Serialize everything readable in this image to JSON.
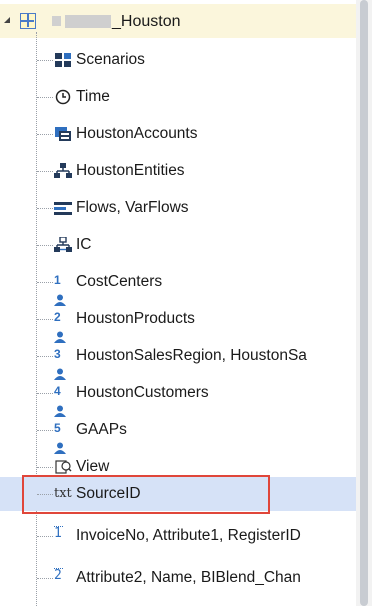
{
  "tree": {
    "root": {
      "label": "_Houston",
      "icon": "cube-grid-icon"
    },
    "items": [
      {
        "label": "Scenarios",
        "icon": "scenarios-icon"
      },
      {
        "label": "Time",
        "icon": "clock-icon"
      },
      {
        "label": "HoustonAccounts",
        "icon": "accounts-icon"
      },
      {
        "label": "HoustonEntities",
        "icon": "hierarchy-icon"
      },
      {
        "label": "Flows, VarFlows",
        "icon": "flows-icon"
      },
      {
        "label": "IC",
        "icon": "ic-hierarchy-icon"
      },
      {
        "label": "CostCenters",
        "icon": "ud1-person-icon",
        "badge": "1"
      },
      {
        "label": "HoustonProducts",
        "icon": "ud2-person-icon",
        "badge": "2"
      },
      {
        "label": "HoustonSalesRegion, HoustonSa",
        "icon": "ud3-person-icon",
        "badge": "3"
      },
      {
        "label": "HoustonCustomers",
        "icon": "ud4-person-icon",
        "badge": "4"
      },
      {
        "label": "GAAPs",
        "icon": "ud5-person-icon",
        "badge": "5"
      },
      {
        "label": "View",
        "icon": "view-icon"
      },
      {
        "label": "SourceID",
        "icon": "txt-icon",
        "glyph": "txt",
        "selected": true
      },
      {
        "label": "InvoiceNo, Attribute1, RegisterID",
        "icon": "attribute-1-icon",
        "glyph": "1"
      },
      {
        "label": "Attribute2, Name, BIBlend_Chan",
        "icon": "attribute-2-icon",
        "glyph": "2"
      }
    ]
  },
  "colors": {
    "accent": "#2f6fbf",
    "selection": "#d6e2f7",
    "highlight_border": "#e0463a",
    "root_background": "#fbf6dc"
  }
}
